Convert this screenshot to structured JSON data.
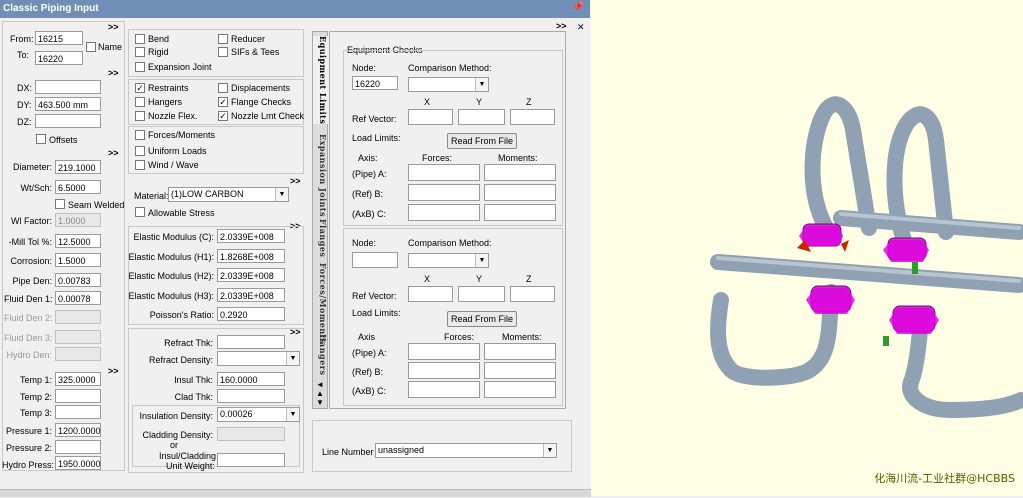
{
  "window_title": "Classic Piping Input",
  "chevron": ">>",
  "nodes": {
    "from_label": "From:",
    "from_value": "16215",
    "to_label": "To:",
    "to_value": "16220",
    "name_label": "Name"
  },
  "deltas": {
    "dx_label": "DX:",
    "dx_value": "",
    "dy_label": "DY:",
    "dy_value": "463.500 mm",
    "dz_label": "DZ:",
    "dz_value": "",
    "offsets_label": "Offsets"
  },
  "section": {
    "diameter_label": "Diameter:",
    "diameter_value": "219.1000",
    "wt_label": "Wt/Sch:",
    "wt_value": "6.5000",
    "seam_label": "Seam Welded",
    "wl_label": "Wl Factor:",
    "wl_value": "1.0000",
    "mill_label": "-Mill Tol %:",
    "mill_value": "12.5000",
    "corr_label": "Corrosion:",
    "corr_value": "1.5000",
    "pipeden_label": "Pipe Den:",
    "pipeden_value": "0.00783",
    "fluid1_label": "Fluid Den 1:",
    "fluid1_value": "0.00078",
    "fluid2_label": "Fluid Den 2:",
    "fluid3_label": "Fluid Den 3:",
    "hydro_den_label": "Hydro Den:"
  },
  "temps": {
    "t1_label": "Temp 1:",
    "t1_value": "325.0000",
    "t2_label": "Temp 2:",
    "t3_label": "Temp 3:",
    "p1_label": "Pressure 1:",
    "p1_value": "1200.0000",
    "p2_label": "Pressure 2:",
    "hp_label": "Hydro Press:",
    "hp_value": "1950.0000"
  },
  "checks1": {
    "bend": "Bend",
    "reducer": "Reducer",
    "rigid": "Rigid",
    "sifs": "SIFs & Tees",
    "expansion": "Expansion Joint"
  },
  "checks2": {
    "restraints": "Restraints",
    "displacements": "Displacements",
    "hangers": "Hangers",
    "flange": "Flange Checks",
    "nozzle_flex": "Nozzle Flex.",
    "nozzle_lmt": "Nozzle Lmt Check"
  },
  "checks3": {
    "forces": "Forces/Moments",
    "uniform": "Uniform Loads",
    "wind": "Wind / Wave"
  },
  "material": {
    "label": "Material:",
    "value": "(1)LOW CARBON",
    "allowable": "Allowable Stress"
  },
  "elastic": {
    "ec_label": "Elastic Modulus (C):",
    "ec_value": "2.0339E+008",
    "eh1_label": "Elastic Modulus (H1):",
    "eh1_value": "1.8268E+008",
    "eh2_label": "Elastic Modulus (H2):",
    "eh2_value": "2.0339E+008",
    "eh3_label": "Elastic Modulus (H3):",
    "eh3_value": "2.0339E+008",
    "poisson_label": "Poisson's Ratio:",
    "poisson_value": "0.2920"
  },
  "insulation": {
    "refract_thk": "Refract Thk:",
    "refract_den": "Refract Density:",
    "insul_thk": "Insul Thk:",
    "insul_thk_value": "160.0000",
    "clad_thk": "Clad Thk:",
    "insul_den": "Insulation Density:",
    "insul_den_value": "0.00026",
    "clad_den": "Cladding Density:",
    "or": "or",
    "unit_w1": "Insul/Cladding",
    "unit_w2": "Unit Weight:"
  },
  "tabs": [
    "Equipment Limits",
    "Expansion Joints",
    "Flanges",
    "Forces/Moments",
    "Hangers"
  ],
  "equip": {
    "group_title": "Equipment Checks",
    "node_label": "Node:",
    "node_value": "16220",
    "node2_value": "",
    "comp_label": "Comparison Method:",
    "x": "X",
    "y": "Y",
    "z": "Z",
    "ref_vector": "Ref Vector:",
    "load_limits": "Load Limits:",
    "read_btn": "Read From File",
    "axis": "Axis:",
    "axis2": "Axis",
    "forces": "Forces:",
    "moments": "Moments:",
    "pipe_a": "(Pipe) A:",
    "ref_b": "(Ref) B:",
    "axb": "(AxB) C:"
  },
  "line_number": {
    "label": "Line Number :",
    "value": "unassigned"
  },
  "watermark": "化海川流-工业社群@HCBBS",
  "colors": {
    "pipe": "#8fa1b3",
    "flange": "#e000e0",
    "background": "#ffffe6",
    "titlebar": "#6f8fb6"
  }
}
